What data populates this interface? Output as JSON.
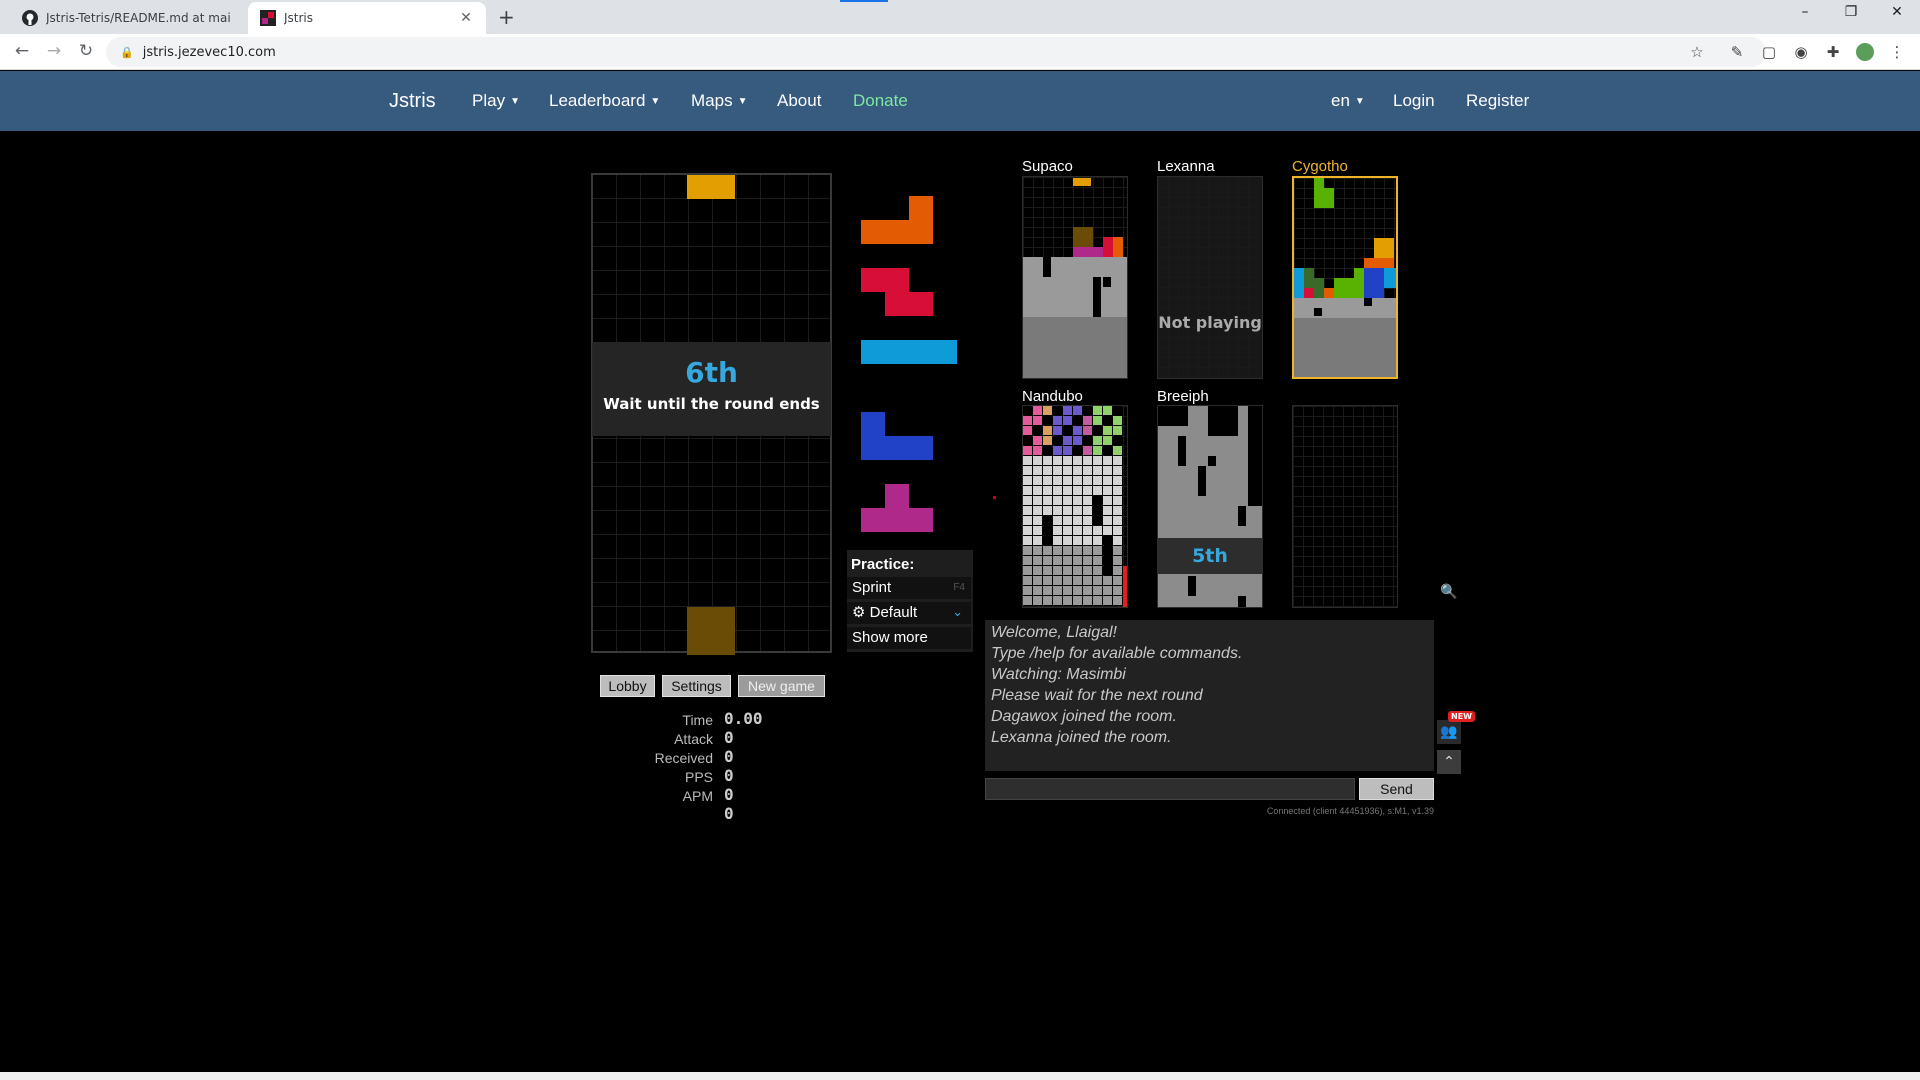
{
  "browser": {
    "tabs": [
      {
        "title": "Jstris-Tetris/README.md at mai",
        "icon": "github-icon"
      },
      {
        "title": "Jstris",
        "icon": "jstris-favicon"
      }
    ],
    "new_tab": "+",
    "url": "jstris.jezevec10.com",
    "window_controls": [
      "–",
      "❐",
      "✕"
    ]
  },
  "nav": {
    "brand": "Jstris",
    "play": "Play",
    "leaderboard": "Leaderboard",
    "maps": "Maps",
    "about": "About",
    "donate": "Donate",
    "lang": "en",
    "login": "Login",
    "register": "Register"
  },
  "game": {
    "place": "6th",
    "message": "Wait until the round ends",
    "queue": [
      "L",
      "Z",
      "I",
      "J",
      "T"
    ],
    "colors": {
      "O": "#e39f02",
      "L": "#e35b02",
      "Z": "#d70f37",
      "I": "#0f9bd7",
      "J": "#2141c6",
      "T": "#af298a",
      "ghost": "#6b4c07"
    }
  },
  "practice": {
    "heading": "Practice:",
    "sprint": "Sprint",
    "sprint_key": "F4",
    "mode": "Default",
    "show_more": "Show more"
  },
  "buttons": {
    "lobby": "Lobby",
    "settings": "Settings",
    "new_game": "New game"
  },
  "stats": [
    {
      "label": "Time",
      "value": "0.00"
    },
    {
      "label": "Attack",
      "value": "0"
    },
    {
      "label": "Received",
      "value": "0"
    },
    {
      "label": "PPS",
      "value": "0"
    },
    {
      "label": "APM",
      "value": "0"
    },
    {
      "label": "",
      "value": "0"
    }
  ],
  "opponents": [
    {
      "name": "Supaco"
    },
    {
      "name": "Lexanna",
      "status": "Not playing"
    },
    {
      "name": "Cygotho"
    },
    {
      "name": "Nandubo"
    },
    {
      "name": "Breeiph",
      "place": "5th"
    },
    {
      "name": ""
    }
  ],
  "chat": {
    "messages": [
      "Welcome, Llaigal!",
      "Type /help for available commands.",
      "Watching: Masimbi",
      "Please wait for the next round",
      "Dagawox joined the room.",
      "Lexanna joined the room."
    ],
    "send": "Send",
    "status": "Connected (client 44451936), s:M1, v1.39",
    "badge": "NEW"
  }
}
